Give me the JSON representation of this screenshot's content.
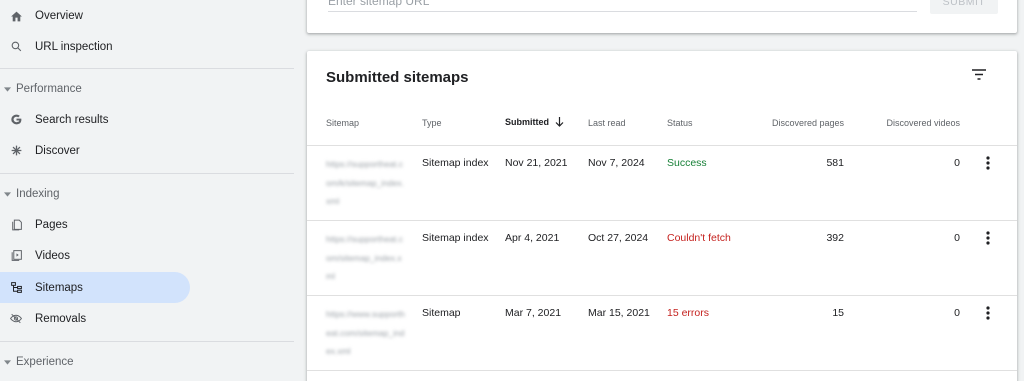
{
  "sidebar": {
    "items": [
      {
        "label": "Overview",
        "icon": "home-icon"
      },
      {
        "label": "URL inspection",
        "icon": "search-icon"
      }
    ],
    "sections": [
      {
        "label": "Performance",
        "items": [
          {
            "label": "Search results",
            "icon": "google-g-icon"
          },
          {
            "label": "Discover",
            "icon": "asterisk-icon"
          }
        ]
      },
      {
        "label": "Indexing",
        "items": [
          {
            "label": "Pages",
            "icon": "pages-icon"
          },
          {
            "label": "Videos",
            "icon": "videos-icon"
          },
          {
            "label": "Sitemaps",
            "icon": "sitemap-icon",
            "active": true
          },
          {
            "label": "Removals",
            "icon": "removals-icon"
          }
        ]
      },
      {
        "label": "Experience",
        "items": []
      }
    ]
  },
  "add_sitemap": {
    "placeholder": "Enter sitemap URL",
    "submit_label": "SUBMIT"
  },
  "submitted": {
    "title": "Submitted sitemaps",
    "columns": {
      "sitemap": "Sitemap",
      "type": "Type",
      "submitted": "Submitted",
      "last_read": "Last read",
      "status": "Status",
      "discovered_pages": "Discovered pages",
      "discovered_videos": "Discovered videos"
    },
    "rows": [
      {
        "url": "https://supportheat.com/k/sitemap_index.xml",
        "type": "Sitemap index",
        "submitted": "Nov 21, 2021",
        "last_read": "Nov 7, 2024",
        "status": "Success",
        "pages": "581",
        "videos": "0"
      },
      {
        "url": "https://supportheat.com/sitemap_index.xml",
        "type": "Sitemap index",
        "submitted": "Apr 4, 2021",
        "last_read": "Oct 27, 2024",
        "status": "Couldn't fetch",
        "pages": "392",
        "videos": "0"
      },
      {
        "url": "https://www.supportheat.com/sitemap_index.xml",
        "type": "Sitemap",
        "submitted": "Mar 7, 2021",
        "last_read": "Mar 15, 2021",
        "status": "15 errors",
        "pages": "15",
        "videos": "0"
      }
    ]
  },
  "colors": {
    "accent_active": "#d2e3fc",
    "success": "#188038",
    "error": "#c5221f"
  }
}
